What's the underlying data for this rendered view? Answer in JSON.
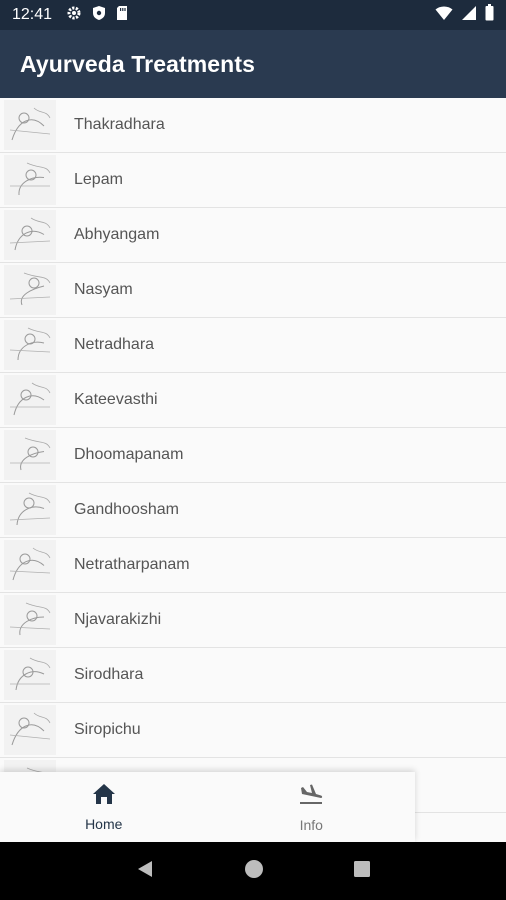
{
  "status_bar": {
    "time": "12:41",
    "icons": [
      "gear-icon",
      "shield-icon",
      "sd-card-icon"
    ],
    "right_icons": [
      "wifi-icon",
      "signal-icon",
      "battery-icon"
    ]
  },
  "app_bar": {
    "title": "Ayurveda Treatments"
  },
  "treatments": [
    {
      "label": "Thakradhara"
    },
    {
      "label": "Lepam"
    },
    {
      "label": "Abhyangam"
    },
    {
      "label": "Nasyam"
    },
    {
      "label": "Netradhara"
    },
    {
      "label": "Kateevasthi"
    },
    {
      "label": "Dhoomapanam"
    },
    {
      "label": "Gandhoosham"
    },
    {
      "label": "Netratharpanam"
    },
    {
      "label": "Njavarakizhi"
    },
    {
      "label": "Sirodhara"
    },
    {
      "label": "Siropichu"
    },
    {
      "label": ""
    },
    {
      "label": ""
    }
  ],
  "bottom_nav": {
    "items": [
      {
        "label": "Home",
        "icon": "home-icon",
        "active": true
      },
      {
        "label": "Info",
        "icon": "flight-land-icon",
        "active": false
      }
    ]
  },
  "system_nav": [
    "back-icon",
    "home-circle-icon",
    "recents-icon"
  ],
  "colors": {
    "app_bar": "#2a3a50",
    "status_bar": "#1d2b3d",
    "list_bg": "#fafafa",
    "active_nav": "#243548"
  }
}
